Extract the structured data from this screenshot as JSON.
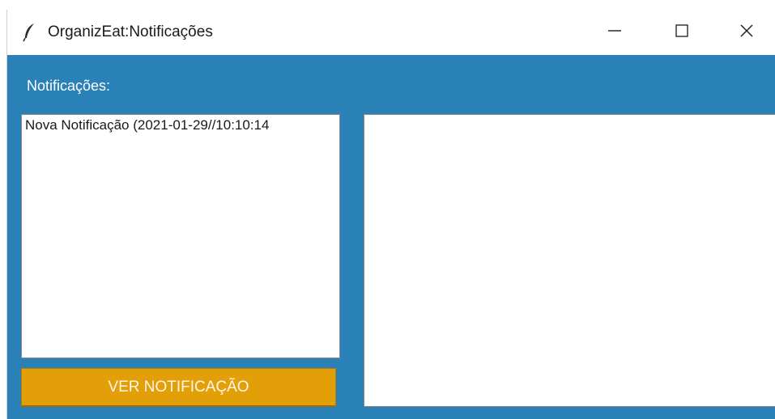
{
  "window": {
    "title": "OrganizEat:Notificações",
    "controls": {
      "minimize": "minimize-icon",
      "maximize": "maximize-icon",
      "close": "close-icon"
    }
  },
  "main": {
    "section_label": "Notificações:",
    "notifications": [
      "Nova Notificação (2021-01-29//10:10:14"
    ],
    "view_button_label": "VER NOTIFICAÇÃO",
    "detail_text": ""
  },
  "colors": {
    "background": "#2a81b8",
    "button": "#e39f07"
  }
}
